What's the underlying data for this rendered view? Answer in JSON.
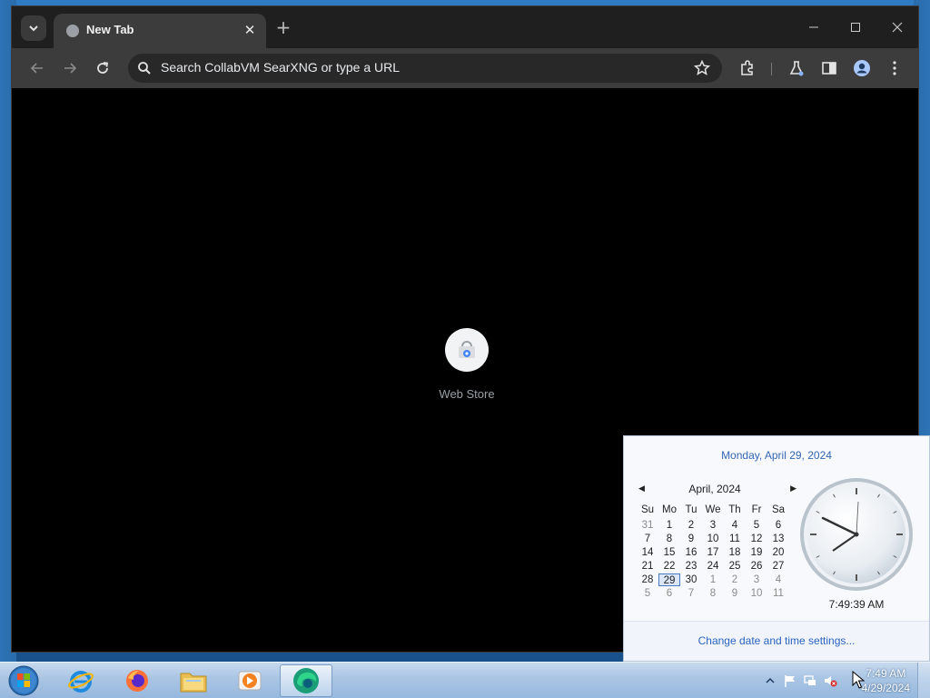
{
  "browser": {
    "tab_title": "New Tab",
    "tab_close": "✕",
    "new_tab": "+",
    "omnibox_placeholder": "Search CollabVM SearXNG or type a URL",
    "icons": [
      "tab-search-icon",
      "globe-icon",
      "back-icon",
      "forward-icon",
      "reload-icon",
      "search-icon",
      "star-icon",
      "extensions-icon",
      "labs-icon",
      "side-panel-icon",
      "profile-icon",
      "menu-icon"
    ],
    "window_controls": {
      "minimize": "—",
      "maximize": "☐",
      "close": "✕"
    }
  },
  "new_tab_page": {
    "shortcut_label": "Web Store"
  },
  "flyout": {
    "date_header": "Monday, April 29, 2024",
    "month_title": "April, 2024",
    "days_of_week": [
      "Su",
      "Mo",
      "Tu",
      "We",
      "Th",
      "Fr",
      "Sa"
    ],
    "weeks": [
      [
        "31",
        "1",
        "2",
        "3",
        "4",
        "5",
        "6"
      ],
      [
        "7",
        "8",
        "9",
        "10",
        "11",
        "12",
        "13"
      ],
      [
        "14",
        "15",
        "16",
        "17",
        "18",
        "19",
        "20"
      ],
      [
        "21",
        "22",
        "23",
        "24",
        "25",
        "26",
        "27"
      ],
      [
        "28",
        "29",
        "30",
        "1",
        "2",
        "3",
        "4"
      ],
      [
        "5",
        "6",
        "7",
        "8",
        "9",
        "10",
        "11"
      ]
    ],
    "selected_day": "29",
    "clock_time": "7:49:39 AM",
    "change_link": "Change date and time settings..."
  },
  "taskbar": {
    "pinned": [
      "internet-explorer-icon",
      "firefox-icon",
      "file-explorer-icon",
      "media-player-icon",
      "edge-browser-icon"
    ],
    "tray_time": "7:49 AM",
    "tray_date": "4/29/2024"
  },
  "colors": {
    "accent": "#3466b4",
    "chrome_dark": "#1f1f1f",
    "chrome_toolbar": "#3c3c3c"
  }
}
